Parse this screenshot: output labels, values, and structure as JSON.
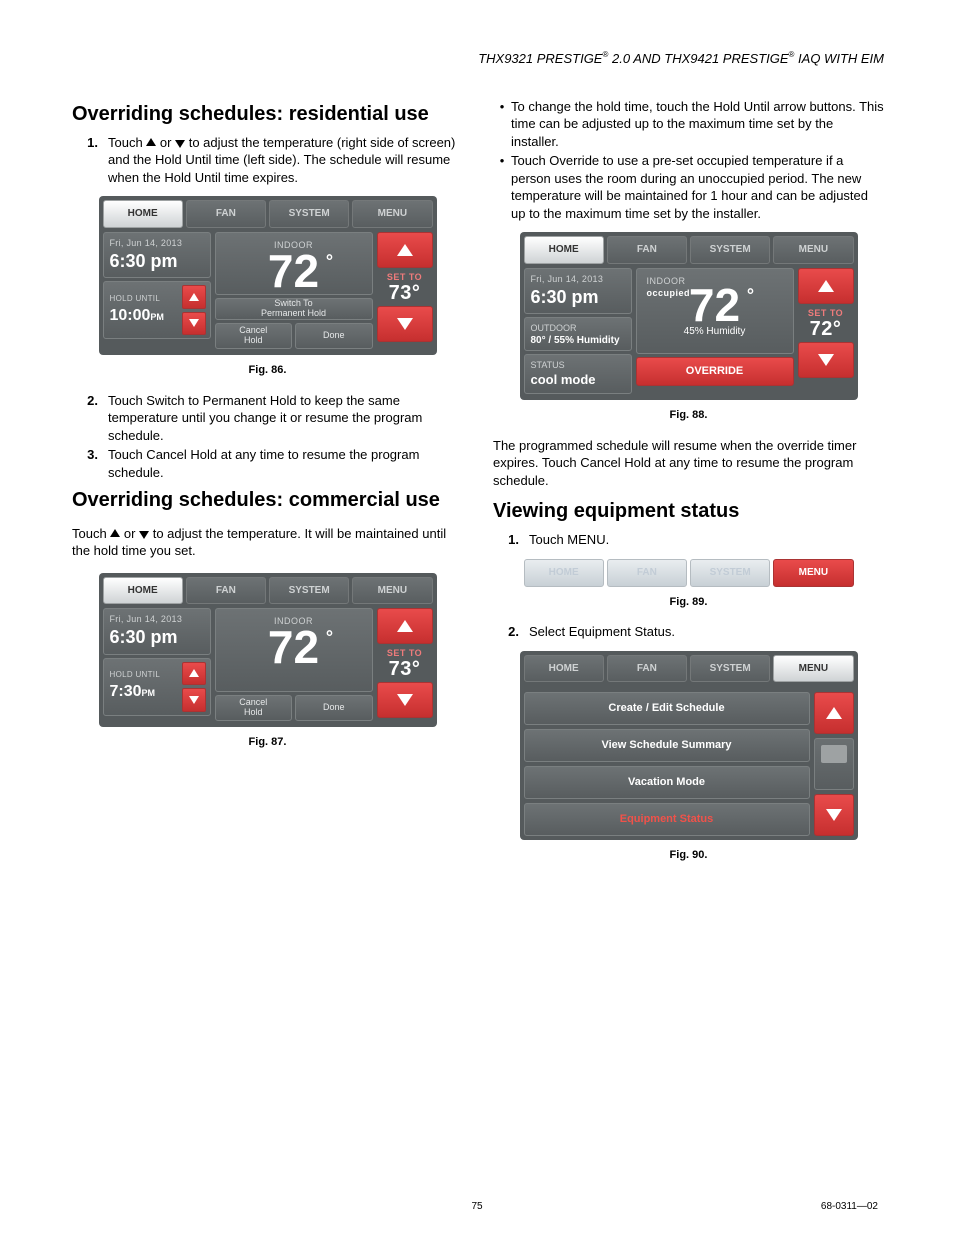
{
  "header": {
    "part1": "THX9321 PRESTIGE",
    "mid": " 2.0 AND THX9421 PRESTIGE",
    "tail": " IAQ WITH EIM"
  },
  "page_number": "75",
  "doc_number": "68-0311—02",
  "left": {
    "h1": "Overriding schedules: residential use",
    "step1": "Touch ▲ or ▼ to adjust the temperature (right side of screen) and the Hold Until time (left side). The schedule will resume when the Hold Until time expires.",
    "fig86": "Fig. 86.",
    "step2": "Touch Switch to Permanent Hold to keep the same temperature until you change it or resume the program schedule.",
    "step3": "Touch Cancel Hold at any time to resume the program schedule.",
    "h2": "Overriding schedules: commercial use",
    "p": "Touch ▲ or ▼ to adjust the temperature. It will be maintained until the hold time you set.",
    "fig87": "Fig. 87."
  },
  "right": {
    "bul1": "To change the hold time, touch the Hold Until arrow buttons. This time can be adjusted up to the maximum time set by the installer.",
    "bul2": "Touch Override to use a pre-set occupied temperature if a person uses the room during an unoccupied period. The new temperature will be maintained for 1 hour and can be adjusted up to the maximum time set by the installer.",
    "fig88": "Fig. 88.",
    "p88": "The programmed schedule will resume when the override timer expires. Touch Cancel Hold at any time to resume the program schedule.",
    "h3": "Viewing equipment status",
    "step1": "Touch MENU.",
    "fig89": "Fig. 89.",
    "step2": "Select Equipment Status.",
    "fig90": "Fig. 90."
  },
  "tabs": {
    "home": "HOME",
    "fan": "FAN",
    "system": "SYSTEM",
    "menu": "MENU"
  },
  "btns": {
    "switch_permanent": "Switch To\nPermanent Hold",
    "cancel_hold": "Cancel\nHold",
    "done": "Done",
    "override": "OVERRIDE",
    "set_to": "SET TO"
  },
  "fig86d": {
    "date": "Fri, Jun 14, 2013",
    "time": "6:30 pm",
    "indoor_label": "INDOOR",
    "indoor_temp": "72",
    "hold_label": "HOLD UNTIL",
    "hold_time": "10:00",
    "hold_pm": "PM",
    "set_temp": "73°"
  },
  "fig87d": {
    "date": "Fri, Jun 14, 2013",
    "time": "6:30 pm",
    "indoor_label": "INDOOR",
    "indoor_temp": "72",
    "hold_label": "HOLD UNTIL",
    "hold_time": "7:30",
    "hold_pm": "PM",
    "set_temp": "73°"
  },
  "fig88d": {
    "date": "Fri, Jun 14, 2013",
    "time": "6:30 pm",
    "indoor_label": "INDOOR",
    "occupied": "occupied",
    "indoor_temp": "72",
    "humidity": "45% Humidity",
    "outdoor_label": "OUTDOOR",
    "outdoor": "80° / 55% Humidity",
    "status_label": "STATUS",
    "status": "cool mode",
    "set_temp": "72°"
  },
  "fig90d": {
    "i1": "Create / Edit Schedule",
    "i2": "View Schedule Summary",
    "i3": "Vacation Mode",
    "i4": "Equipment Status"
  }
}
